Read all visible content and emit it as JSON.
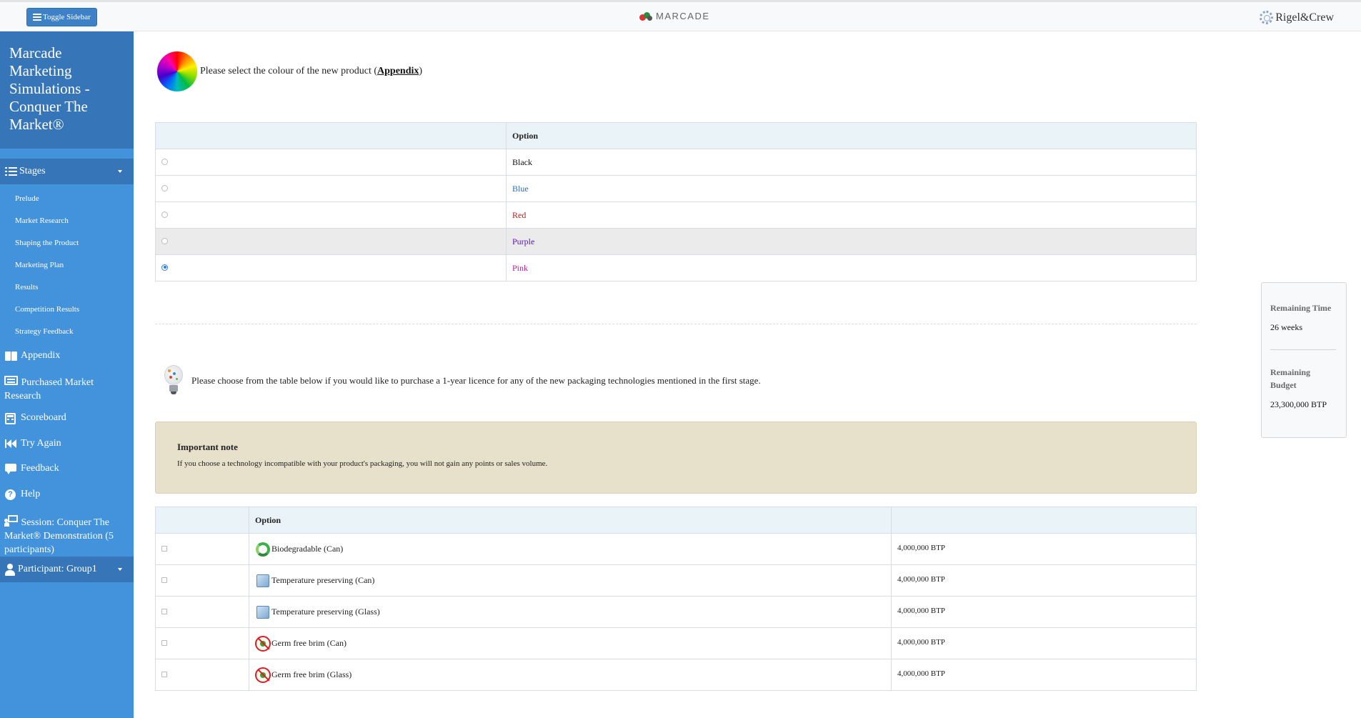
{
  "topbar": {
    "toggle_label": "Toggle Sidebar",
    "brand_center": "MARCADE",
    "brand_right": "Rigel&Crew"
  },
  "sidebar": {
    "title": "Marcade Marketing Simulations - Conquer The Market®",
    "stages_label": "Stages",
    "stages": [
      "Prelude",
      "Market Research",
      "Shaping the Product",
      "Marketing Plan",
      "Results",
      "Competition Results",
      "Strategy Feedback"
    ],
    "items": [
      {
        "label": "Appendix",
        "icon": "book-icon"
      },
      {
        "label": "Purchased Market Research",
        "icon": "research-icon"
      },
      {
        "label": "Scoreboard",
        "icon": "calculator-icon"
      },
      {
        "label": "Try Again",
        "icon": "rewind-icon"
      },
      {
        "label": "Feedback",
        "icon": "comment-icon"
      },
      {
        "label": "Help",
        "icon": "help-icon"
      },
      {
        "label": "Session: Conquer The Market® Demonstration (5 participants)",
        "icon": "presentation-icon"
      }
    ],
    "participant_label": "Participant: Group1"
  },
  "colour_question": {
    "text_before": "Please select the colour of the new product (",
    "link": "Appendix",
    "text_after": ")",
    "header_option": "Option",
    "options": [
      {
        "label": "Black",
        "color": "#111111",
        "selected": false
      },
      {
        "label": "Blue",
        "color": "#2a6fb3",
        "selected": false
      },
      {
        "label": "Red",
        "color": "#b31e1e",
        "selected": false
      },
      {
        "label": "Purple",
        "color": "#5a1aa8",
        "selected": false
      },
      {
        "label": "Pink",
        "color": "#b5239a",
        "selected": true
      }
    ]
  },
  "tech_question": {
    "text": "Please choose from the table below if you would like to purchase a 1-year licence for any of the new packaging technologies mentioned in the first stage.",
    "note_title": "Important note",
    "note_text": "If you choose a technology incompatible with your product's packaging, you will not gain any points or sales volume.",
    "header_option": "Option",
    "options": [
      {
        "label": "Biodegradable (Can)",
        "price": "4,000,000 BTP",
        "icon": "recycle-icon"
      },
      {
        "label": "Temperature preserving (Can)",
        "price": "4,000,000 BTP",
        "icon": "ice-cube-icon"
      },
      {
        "label": "Temperature preserving (Glass)",
        "price": "4,000,000 BTP",
        "icon": "ice-cube-icon"
      },
      {
        "label": "Germ free brim (Can)",
        "price": "4,000,000 BTP",
        "icon": "no-germ-icon"
      },
      {
        "label": "Germ free brim (Glass)",
        "price": "4,000,000 BTP",
        "icon": "no-germ-icon"
      }
    ]
  },
  "remaining": {
    "time_label": "Remaining Time",
    "time_value": "26 weeks",
    "budget_label": "Remaining Budget",
    "budget_value": "23,300,000 BTP"
  }
}
